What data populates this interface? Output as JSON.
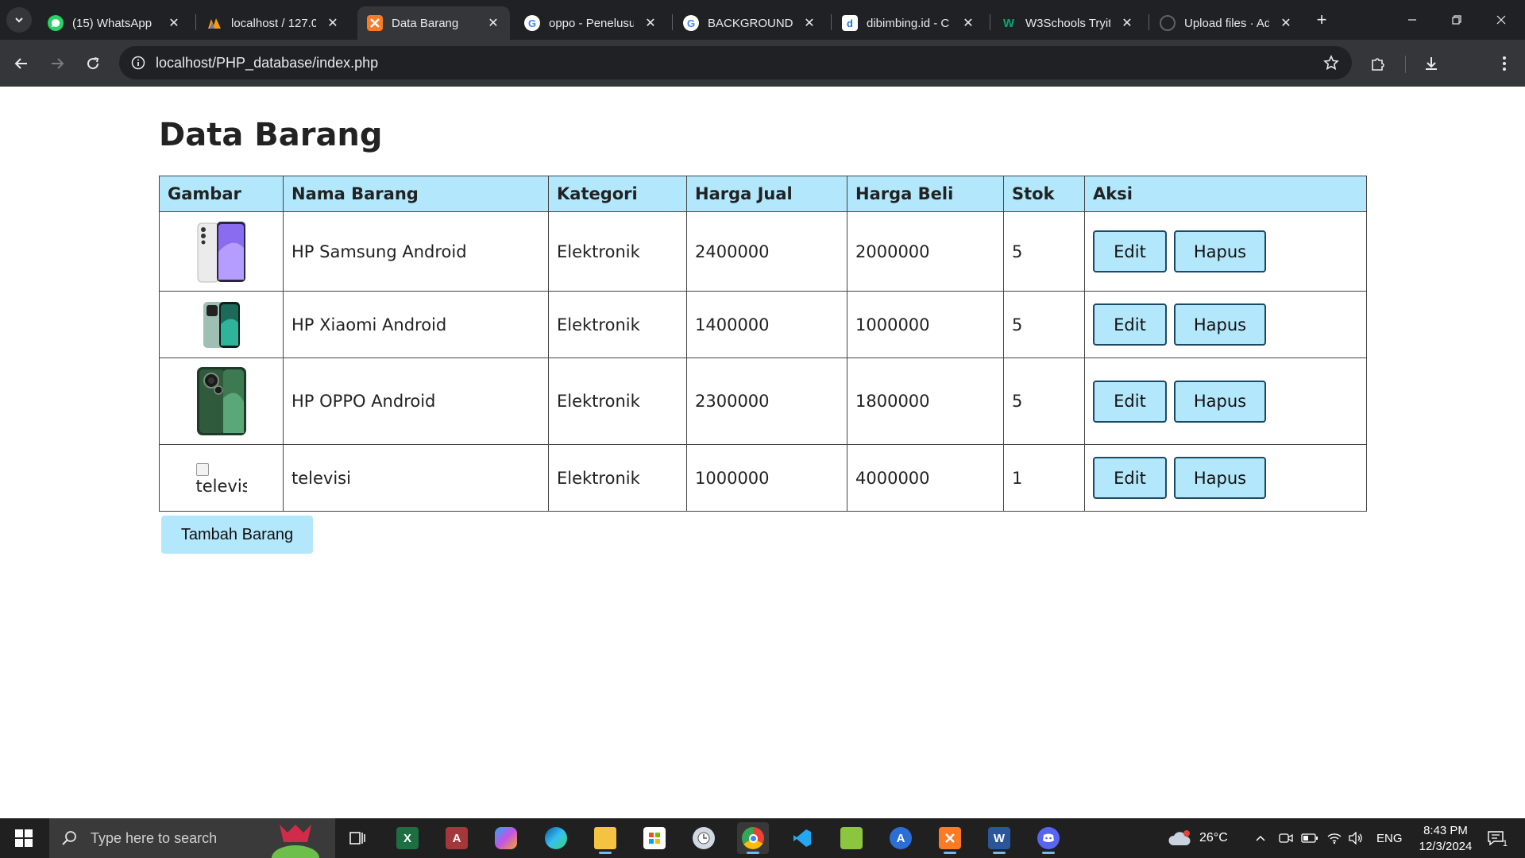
{
  "browser": {
    "tabs": [
      {
        "title": "(15) WhatsApp",
        "icon": "whatsapp-icon",
        "color": "#25d366"
      },
      {
        "title": "localhost / 127.0",
        "icon": "phpmyadmin-icon",
        "color": "#f89c0e"
      },
      {
        "title": "Data Barang",
        "icon": "xampp-icon",
        "color": "#fb7a24",
        "active": true
      },
      {
        "title": "oppo - Penelusur",
        "icon": "google-icon",
        "color": "#4285f4"
      },
      {
        "title": "BACKGROUND W",
        "icon": "google-icon",
        "color": "#4285f4"
      },
      {
        "title": "dibimbing.id - C",
        "icon": "dibimbing-icon",
        "color": "#1a73e8"
      },
      {
        "title": "W3Schools Tryit",
        "icon": "w3schools-icon",
        "color": "#04aa6d"
      },
      {
        "title": "Upload files · Ad",
        "icon": "github-icon",
        "color": "#5f6368"
      }
    ],
    "url": "localhost/PHP_database/index.php"
  },
  "page": {
    "title": "Data Barang",
    "columns": [
      "Gambar",
      "Nama Barang",
      "Kategori",
      "Harga Jual",
      "Harga Beli",
      "Stok",
      "Aksi"
    ],
    "rows": [
      {
        "image": "samsung-phone",
        "image_alt": "",
        "name": "HP Samsung Android",
        "category": "Elektronik",
        "sell_price": "2400000",
        "buy_price": "2000000",
        "stock": "5"
      },
      {
        "image": "xiaomi-phone",
        "image_alt": "",
        "name": "HP Xiaomi Android",
        "category": "Elektronik",
        "sell_price": "1400000",
        "buy_price": "1000000",
        "stock": "5"
      },
      {
        "image": "oppo-phone",
        "image_alt": "",
        "name": "HP OPPO Android",
        "category": "Elektronik",
        "sell_price": "2300000",
        "buy_price": "1800000",
        "stock": "5"
      },
      {
        "image": "broken",
        "image_alt": "televis",
        "name": "televisi",
        "category": "Elektronik",
        "sell_price": "1000000",
        "buy_price": "4000000",
        "stock": "1"
      }
    ],
    "edit_label": "Edit",
    "delete_label": "Hapus",
    "add_label": "Tambah Barang"
  },
  "taskbar": {
    "search_placeholder": "Type here to search",
    "apps": [
      "task-view",
      "excel",
      "access",
      "copilot",
      "edge",
      "file-explorer",
      "microsoft-store",
      "clock-app",
      "chrome",
      "vscode",
      "notepad-plus-plus",
      "app-icon",
      "xampp",
      "word",
      "discord"
    ],
    "active_app": "chrome",
    "weather": "26°C",
    "language": "ENG",
    "time": "8:43 PM",
    "date": "12/3/2024",
    "notification_count": "1"
  },
  "colors": {
    "accent": "#b3e7fb",
    "button_border": "#1b4a66"
  }
}
